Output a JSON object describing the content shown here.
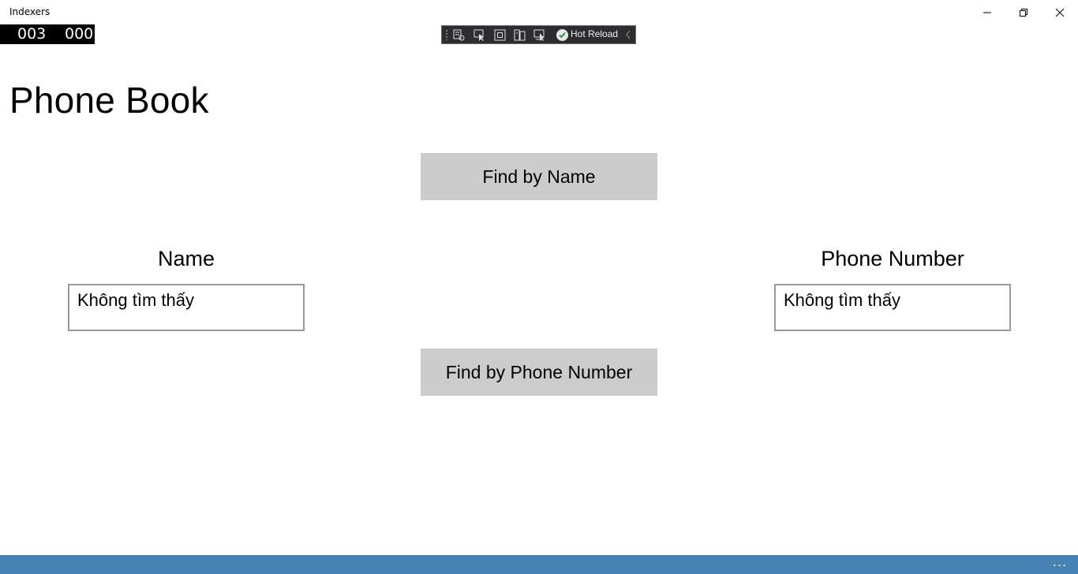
{
  "window": {
    "title": "Indexers",
    "minimize_icon": "minimize-icon",
    "restore_icon": "restore-icon",
    "close_icon": "close-icon"
  },
  "frame_counter": {
    "left_value": "003",
    "right_value": "000"
  },
  "debug_toolbar": {
    "hot_reload_label": "Hot Reload",
    "icons": [
      "live-visual-tree-icon",
      "select-element-icon",
      "display-adorners-icon",
      "track-focus-icon",
      "binding-failures-icon",
      "hot-reload-check-icon",
      "collapse-toolbar-icon"
    ]
  },
  "page": {
    "title": "Phone Book",
    "find_by_name_label": "Find by Name",
    "find_by_phone_label": "Find by Phone Number",
    "name_label": "Name",
    "phone_label": "Phone Number",
    "name_value": "Không tìm thấy",
    "phone_value": "Không tìm thấy"
  },
  "app_bar": {
    "more_label": "...",
    "color": "#4682b4"
  }
}
